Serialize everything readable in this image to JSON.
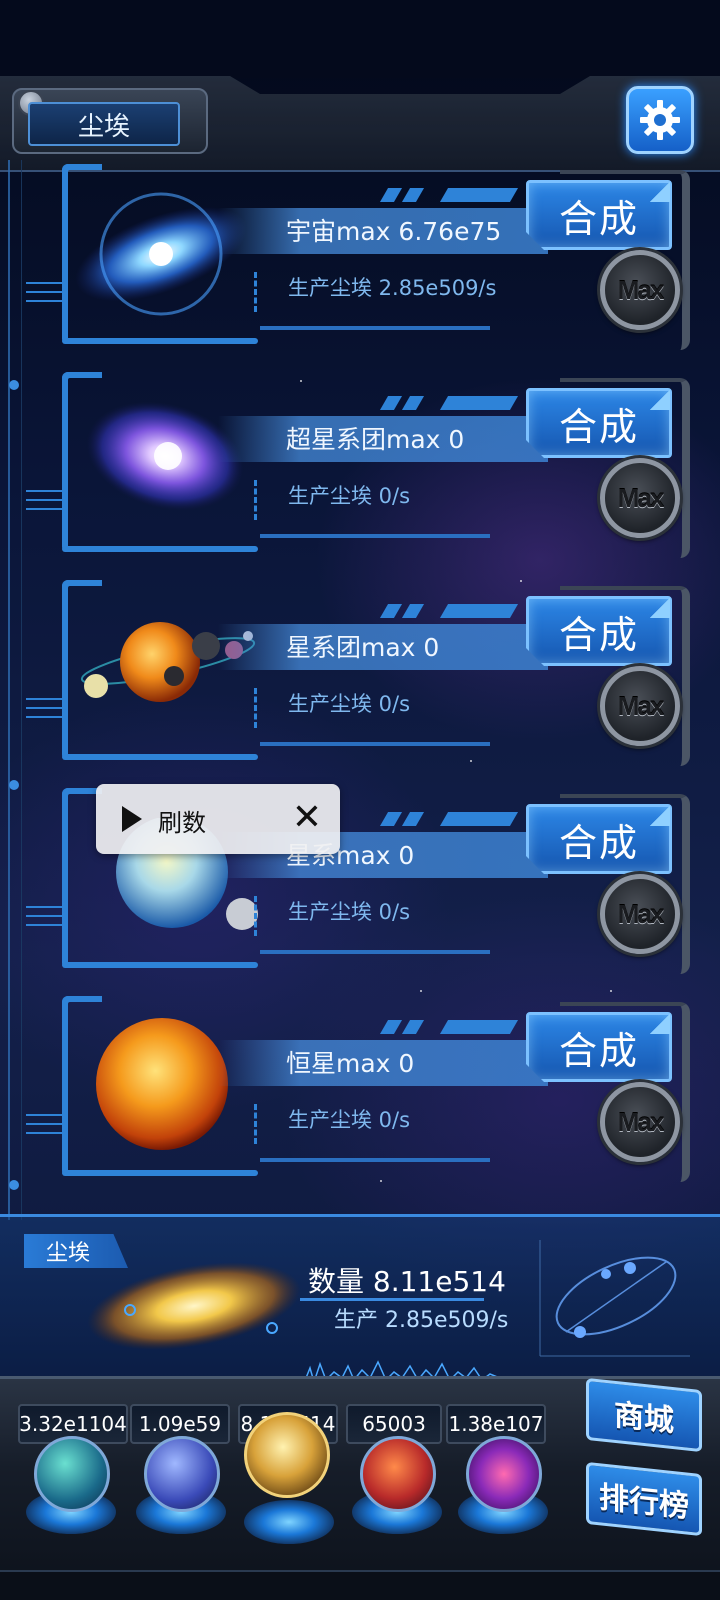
{
  "header": {
    "tab_label": "尘埃"
  },
  "rows": [
    {
      "name": "宇宙max 6.76e75",
      "production": "生产尘埃  2.85e509/s",
      "combine_label": "合成",
      "max_label": "Max",
      "icon": "universe-galaxy-icon"
    },
    {
      "name": "超星系团max 0",
      "production": "生产尘埃  0/s",
      "combine_label": "合成",
      "max_label": "Max",
      "icon": "supercluster-galaxy-icon"
    },
    {
      "name": "星系团max 0",
      "production": "生产尘埃  0/s",
      "combine_label": "合成",
      "max_label": "Max",
      "icon": "cluster-planets-icon"
    },
    {
      "name": "星系max 0",
      "production": "生产尘埃  0/s",
      "combine_label": "合成",
      "max_label": "Max",
      "icon": "galaxy-planet-icon"
    },
    {
      "name": "恒星max 0",
      "production": "生产尘埃  0/s",
      "combine_label": "合成",
      "max_label": "Max",
      "icon": "star-sun-icon"
    }
  ],
  "popup": {
    "label": "刷数"
  },
  "dust_panel": {
    "tag": "尘埃",
    "count": "数量 8.11e514",
    "production": "生产 2.85e509/s"
  },
  "resources": [
    {
      "value": "3.32e1104",
      "icon": "molecule-orb-icon"
    },
    {
      "value": "1.09e59",
      "icon": "lightning-orb-icon"
    },
    {
      "value": "8.11e514",
      "icon": "dust-orb-icon"
    },
    {
      "value": "65003",
      "icon": "neural-orb-icon"
    },
    {
      "value": "1.38e107",
      "icon": "vortex-orb-icon"
    }
  ],
  "side_buttons": {
    "shop": "商城",
    "ranking": "排行榜"
  },
  "colors": {
    "accent": "#2e83d8",
    "button_blue": "#2c86e6",
    "panel_bg": "#0a1538"
  }
}
